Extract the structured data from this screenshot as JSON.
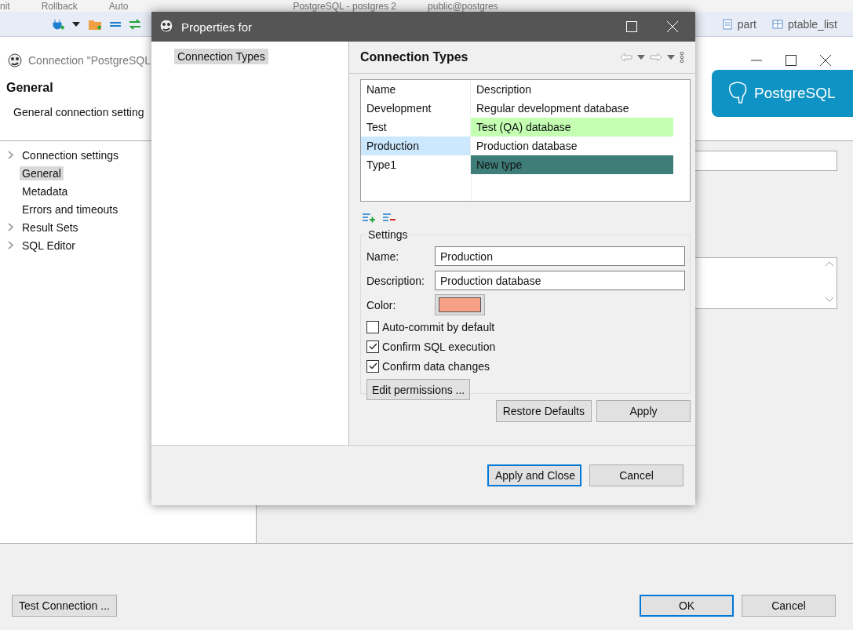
{
  "background_window": {
    "toolbar_texts": [
      "nit",
      "Rollback",
      "Auto",
      "PostgreSQL - postgres 2",
      "public@postgres"
    ],
    "editor_tabs": [
      "part",
      "ptable_list"
    ],
    "title": "Connection \"PostgreSQL",
    "heading": "General",
    "description": "General connection setting",
    "logo_text": "PostgreSQL",
    "tree": [
      {
        "label": "Connection settings",
        "expandable": true,
        "selected": false
      },
      {
        "label": "General",
        "expandable": false,
        "selected": true
      },
      {
        "label": "Metadata",
        "expandable": false,
        "selected": false
      },
      {
        "label": "Errors and timeouts",
        "expandable": false,
        "selected": false
      },
      {
        "label": "Result Sets",
        "expandable": true,
        "selected": false
      },
      {
        "label": "SQL Editor",
        "expandable": true,
        "selected": false
      }
    ],
    "buttons": [
      {
        "label": "Test Connection ...",
        "default": false
      },
      {
        "label": "OK",
        "default": true
      },
      {
        "label": "Cancel",
        "default": false
      }
    ]
  },
  "dialog": {
    "title": "Properties for",
    "nav": [
      {
        "label": "Connection Types",
        "selected": true
      }
    ],
    "page_title": "Connection Types",
    "table": {
      "columns": [
        "Name",
        "Description"
      ],
      "rows": [
        {
          "name": "Development",
          "description": "Regular development database",
          "selected": false
        },
        {
          "name": "Test",
          "description": "Test (QA) database",
          "color": "#c4ffb2",
          "selected": false
        },
        {
          "name": "Production",
          "description": "Production database",
          "selected": true
        },
        {
          "name": "Type1",
          "description": "New type",
          "color": "#3e7d78",
          "selected": false
        }
      ]
    },
    "settings": {
      "legend": "Settings",
      "name_label": "Name:",
      "name_value": "Production",
      "description_label": "Description:",
      "description_value": "Production database",
      "color_label": "Color:",
      "color": "#f6a085",
      "checkboxes": [
        {
          "label": "Auto-commit by default",
          "checked": false
        },
        {
          "label": "Confirm SQL execution",
          "checked": true
        },
        {
          "label": "Confirm data changes",
          "checked": true
        }
      ],
      "edit_button": "Edit permissions ..."
    },
    "page_buttons": [
      "Restore Defaults",
      "Apply"
    ],
    "buttons": [
      {
        "label": "Apply and Close",
        "default": true
      },
      {
        "label": "Cancel",
        "default": false
      }
    ]
  }
}
